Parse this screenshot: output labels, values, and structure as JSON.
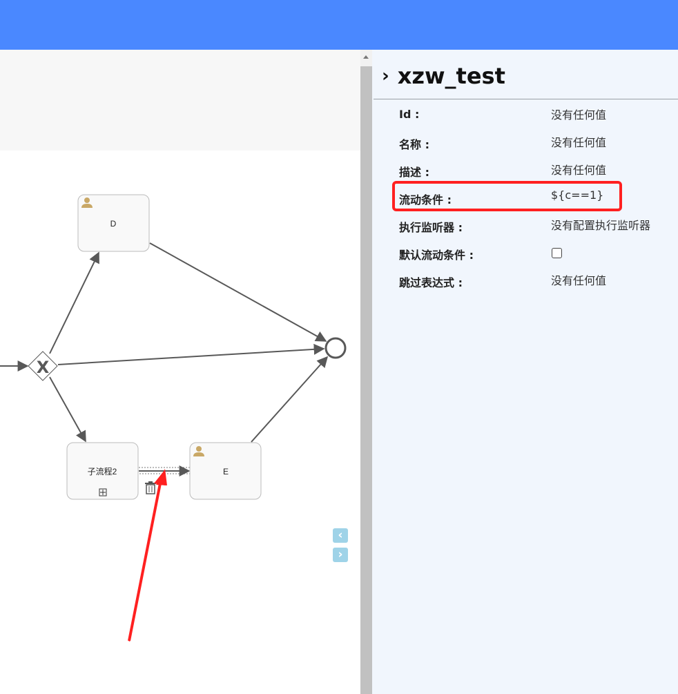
{
  "topbar": {},
  "diagram": {
    "tasks": [
      {
        "id": "task-d",
        "label": "D",
        "type": "user-task"
      },
      {
        "id": "task-subprocess-2",
        "label": "子流程2",
        "type": "sub-process"
      },
      {
        "id": "task-e",
        "label": "E",
        "type": "user-task"
      }
    ],
    "gateway": {
      "label": "X",
      "type": "exclusive-gateway"
    },
    "end_event": {
      "type": "end-event"
    },
    "selected_flow": {
      "from": "子流程2",
      "to": "E",
      "selected": true
    },
    "icons": {
      "user_task": "user-icon",
      "subprocess_marker": "plus-box-icon",
      "delete": "trash-icon",
      "nav_prev": "chevron-left-icon",
      "nav_next": "chevron-right-icon"
    },
    "colors": {
      "task_fill": "#f9f9f9",
      "task_stroke": "#bbbbbb",
      "flow": "#585858",
      "user_icon": "#c9a866"
    }
  },
  "nav": {
    "prev_glyph": "‹",
    "next_glyph": "›"
  },
  "properties_panel": {
    "chevron": "›",
    "title": "xzw_test",
    "rows": [
      {
        "label": "Id :",
        "value": "没有任何值",
        "kind": "text"
      },
      {
        "label": "名称 :",
        "value": "没有任何值",
        "kind": "text"
      },
      {
        "label": "描述 :",
        "value": "没有任何值",
        "kind": "text"
      },
      {
        "label": "流动条件 :",
        "value": "${c==1}",
        "kind": "text",
        "highlighted": true
      },
      {
        "label": "执行监听器 :",
        "value": "没有配置执行监听器",
        "kind": "text"
      },
      {
        "label": "默认流动条件 :",
        "value": "",
        "kind": "checkbox",
        "checked": false
      },
      {
        "label": "跳过表达式 :",
        "value": "没有任何值",
        "kind": "text"
      }
    ]
  },
  "annotation": {
    "color": "#ff2020"
  },
  "colors": {
    "topbar": "#4a88ff",
    "panel_bg": "#f1f6fd",
    "toolbar_bg": "#f7f7f7",
    "scrollbar": "#c1c1c1"
  }
}
